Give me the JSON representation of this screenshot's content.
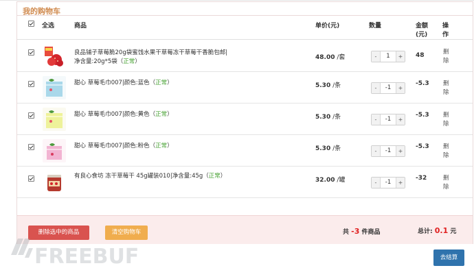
{
  "cart": {
    "title": "我的购物车",
    "header": {
      "select_all": "全选",
      "product": "商品",
      "unit_price": "单价(元)",
      "quantity": "数量",
      "amount_line1": "金额",
      "amount_line2": "(元)",
      "action_line1": "操",
      "action_line2": "作"
    },
    "items": [
      {
        "name": "良品铺子草莓脆20g袋蜜饯水果干草莓冻干草莓干香脆包邮|净含量:20g*5袋（",
        "status": "正常",
        "name_tail": "）",
        "price": "48.00",
        "unit": "/套",
        "qty": "1",
        "amount": "48",
        "delete_line1": "删",
        "delete_line2": "除"
      },
      {
        "name": "甜心 草莓毛巾007|颜色:蓝色（",
        "status": "正常",
        "name_tail": "）",
        "price": "5.30",
        "unit": "/条",
        "qty": "-1",
        "amount": "-5.3",
        "delete_line1": "删",
        "delete_line2": "除"
      },
      {
        "name": "甜心 草莓毛巾007|颜色:黄色（",
        "status": "正常",
        "name_tail": "）",
        "price": "5.30",
        "unit": "/条",
        "qty": "-1",
        "amount": "-5.3",
        "delete_line1": "删",
        "delete_line2": "除"
      },
      {
        "name": "甜心 草莓毛巾007|颜色:粉色（",
        "status": "正常",
        "name_tail": "）",
        "price": "5.30",
        "unit": "/条",
        "qty": "-1",
        "amount": "-5.3",
        "delete_line1": "删",
        "delete_line2": "除"
      },
      {
        "name": "有良心食坊 冻干草莓干 45g罐装010|净含量:45g（",
        "status": "正常",
        "name_tail": "）",
        "price": "32.00",
        "unit": "/罐",
        "qty": "-1",
        "amount": "-32",
        "delete_line1": "删",
        "delete_line2": "除"
      }
    ],
    "stepper_minus": "-",
    "stepper_plus": "+",
    "footer": {
      "delete_selected": "删除选中的商品",
      "clear_cart": "清空购物车",
      "count_prefix": "共",
      "count_value": "-3",
      "count_suffix": "件商品",
      "total_label": "总计:",
      "total_value": "0.1",
      "total_unit": "元"
    },
    "checkout": "去结算"
  },
  "watermark": "FREEBUF",
  "colors": {
    "title": "#d08a4e",
    "danger": "#d9534f",
    "warning": "#f0ad4e",
    "primary": "#2f73ad",
    "status_ok": "#4aa336",
    "highlight": "#e02020",
    "footer_bg": "#fbecec"
  }
}
